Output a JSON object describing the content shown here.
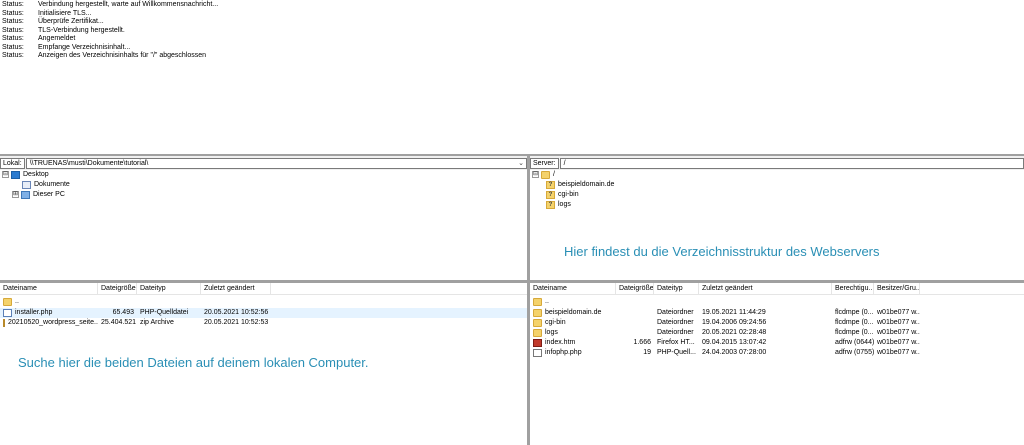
{
  "log": [
    {
      "label": "Status:",
      "msg": "Verbindung hergestellt, warte auf Willkommensnachricht..."
    },
    {
      "label": "Status:",
      "msg": "Initialisiere TLS..."
    },
    {
      "label": "Status:",
      "msg": "Überprüfe Zertifikat..."
    },
    {
      "label": "Status:",
      "msg": "TLS-Verbindung hergestellt."
    },
    {
      "label": "Status:",
      "msg": "Angemeldet"
    },
    {
      "label": "Status:",
      "msg": "Empfange Verzeichnisinhalt..."
    },
    {
      "label": "Status:",
      "msg": "Anzeigen des Verzeichnisinhalts für \"/\" abgeschlossen"
    }
  ],
  "local": {
    "label": "Lokal:",
    "path": "\\\\TRUENAS\\musti\\Dokumente\\tutorial\\",
    "tree": [
      {
        "toggle": "⊟",
        "label": "Desktop",
        "icon": "desktop-icon"
      },
      {
        "toggle": "",
        "label": "Dokumente",
        "icon": "documents-icon"
      },
      {
        "toggle": "⊞",
        "label": "Dieser PC",
        "icon": "computer-icon"
      }
    ],
    "columns": [
      "Dateiname",
      "Dateigröße",
      "Dateityp",
      "Zuletzt geändert"
    ],
    "files": [
      {
        "name": "..",
        "size": "",
        "type": "",
        "modified": "",
        "icon": "folder-icon"
      },
      {
        "name": "installer.php",
        "size": "65.493",
        "type": "PHP-Quelldatei",
        "modified": "20.05.2021 10:52:56",
        "icon": "php-file-icon"
      },
      {
        "name": "20210520_wordpress_seite...",
        "size": "25.404.521",
        "type": "zip Archive",
        "modified": "20.05.2021 10:52:53",
        "icon": "zip-file-icon"
      }
    ],
    "hint": "Suche hier die beiden Dateien auf deinem lokalen Computer."
  },
  "remote": {
    "label": "Server:",
    "path": "/",
    "tree": [
      {
        "toggle": "⊟",
        "label": "/",
        "icon": "folder-icon"
      },
      {
        "toggle": "",
        "label": "beispieldomain.de",
        "icon": "unknown-folder-icon"
      },
      {
        "toggle": "",
        "label": "cgi-bin",
        "icon": "unknown-folder-icon"
      },
      {
        "toggle": "",
        "label": "logs",
        "icon": "unknown-folder-icon"
      }
    ],
    "columns": [
      "Dateiname",
      "Dateigröße",
      "Dateityp",
      "Zuletzt geändert",
      "Berechtigu...",
      "Besitzer/Gru..."
    ],
    "files": [
      {
        "name": "..",
        "size": "",
        "type": "",
        "modified": "",
        "perm": "",
        "owner": "",
        "icon": "folder-icon"
      },
      {
        "name": "beispieldomain.de",
        "size": "",
        "type": "Dateiordner",
        "modified": "19.05.2021 11:44:29",
        "perm": "flcdmpe (0...",
        "owner": "w01be077 w...",
        "icon": "folder-icon"
      },
      {
        "name": "cgi-bin",
        "size": "",
        "type": "Dateiordner",
        "modified": "19.04.2006 09:24:56",
        "perm": "flcdmpe (0...",
        "owner": "w01be077 w...",
        "icon": "folder-icon"
      },
      {
        "name": "logs",
        "size": "",
        "type": "Dateiordner",
        "modified": "20.05.2021 02:28:48",
        "perm": "flcdmpe (0...",
        "owner": "w01be077 w...",
        "icon": "folder-icon"
      },
      {
        "name": "index.htm",
        "size": "1.666",
        "type": "Firefox HT...",
        "modified": "09.04.2015 13:07:42",
        "perm": "adfrw (0644)",
        "owner": "w01be077 w...",
        "icon": "html-file-icon"
      },
      {
        "name": "infophp.php",
        "size": "19",
        "type": "PHP-Quell...",
        "modified": "24.04.2003 07:28:00",
        "perm": "adfrw (0755)",
        "owner": "w01be077 w...",
        "icon": "php-file-icon"
      }
    ],
    "hint": "Hier findest du die Verzeichnisstruktur des Webservers"
  }
}
